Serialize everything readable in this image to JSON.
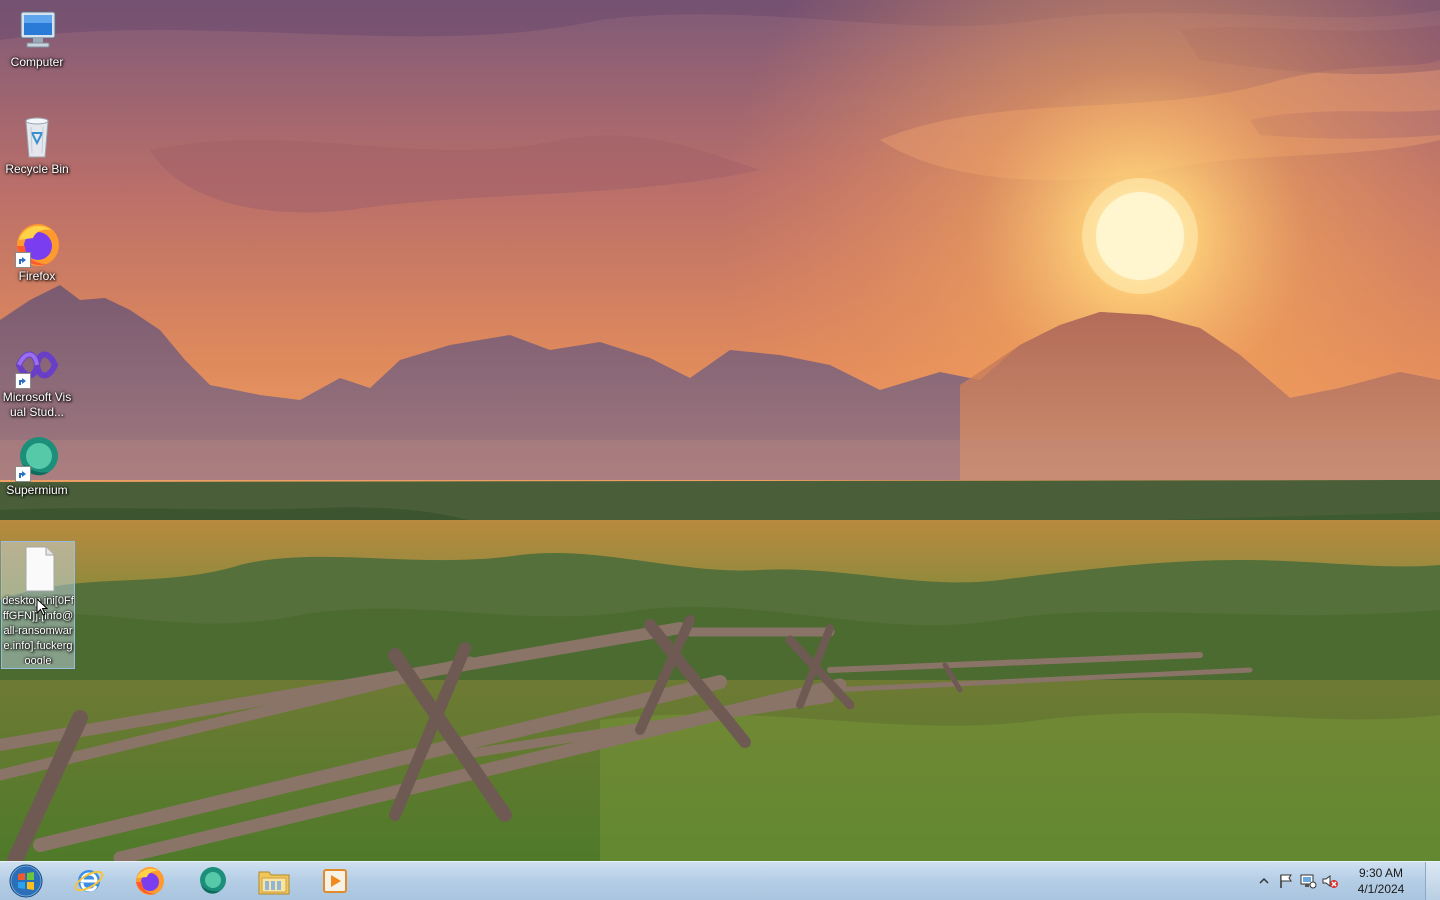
{
  "desktop": {
    "icons": [
      {
        "label": "Computer",
        "icon": "computer-icon"
      },
      {
        "label": "Recycle Bin",
        "icon": "recycle-bin-icon"
      },
      {
        "label": "Firefox",
        "icon": "firefox-icon"
      },
      {
        "label": "Microsoft Visual Stud...",
        "icon": "visual-studio-icon"
      },
      {
        "label": "Supermium",
        "icon": "supermium-icon"
      },
      {
        "label": "desktop.ini[0FfffGFN]].[info@all-ransomware.info].fuckergoogle",
        "icon": "file-icon"
      }
    ]
  },
  "taskbar": {
    "start": "start-orb-icon",
    "pinned": [
      {
        "name": "internet-explorer",
        "icon": "internet-explorer-icon"
      },
      {
        "name": "firefox",
        "icon": "firefox-icon"
      },
      {
        "name": "supermium",
        "icon": "supermium-icon"
      },
      {
        "name": "file-explorer",
        "icon": "file-explorer-icon"
      },
      {
        "name": "media-player",
        "icon": "media-player-icon"
      }
    ],
    "tray": {
      "icons": [
        "show-hidden-icons-icon",
        "action-center-flag-icon",
        "network-icon",
        "volume-muted-icon"
      ],
      "time": "9:30 AM",
      "date": "4/1/2024"
    }
  },
  "colors": {
    "taskbar": "#b6cfe6",
    "sky_top": "#8a5a78",
    "sky_horizon": "#f2a35a",
    "sun": "#fff3c8"
  }
}
